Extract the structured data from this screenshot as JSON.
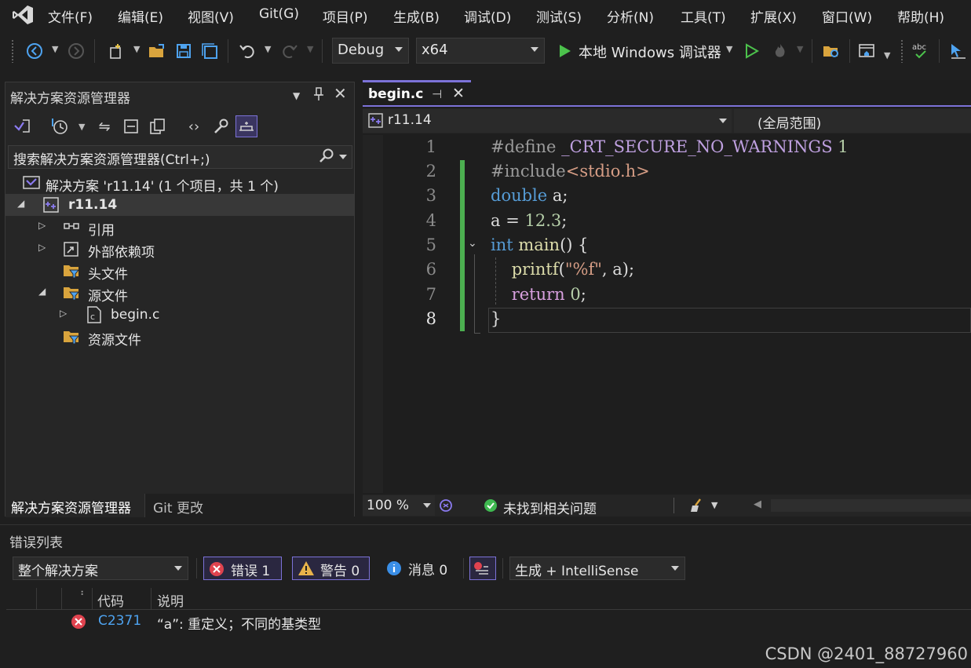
{
  "menubar": {
    "items": [
      "文件(F)",
      "编辑(E)",
      "视图(V)",
      "Git(G)",
      "项目(P)",
      "生成(B)",
      "调试(D)",
      "测试(S)",
      "分析(N)",
      "工具(T)",
      "扩展(X)",
      "窗口(W)",
      "帮助(H)"
    ]
  },
  "toolbar": {
    "configuration": "Debug",
    "platform": "x64",
    "run_label": "本地 Windows 调试器"
  },
  "solution_explorer": {
    "title": "解决方案资源管理器",
    "search_placeholder": "搜索解决方案资源管理器(Ctrl+;)",
    "tree": [
      {
        "label": "解决方案 'r11.14' (1 个项目，共 1 个)"
      },
      {
        "label": "r11.14"
      },
      {
        "label": "引用"
      },
      {
        "label": "外部依赖项"
      },
      {
        "label": "头文件"
      },
      {
        "label": "源文件"
      },
      {
        "label": "begin.c"
      },
      {
        "label": "资源文件"
      }
    ],
    "tabs": [
      "解决方案资源管理器",
      "Git 更改"
    ]
  },
  "editor": {
    "tab_name": "begin.c",
    "nav_scope": "r11.14",
    "nav_member": "(全局范围)",
    "lines": [
      "1",
      "2",
      "3",
      "4",
      "5",
      "6",
      "7",
      "8"
    ],
    "zoom": "100 %",
    "issues": "未找到相关问题"
  },
  "error_list": {
    "title": "错误列表",
    "scope": "整个解决方案",
    "errors_label": "错误 1",
    "warnings_label": "警告 0",
    "messages_label": "消息 0",
    "source": "生成 + IntelliSense",
    "columns": {
      "code": "代码",
      "description": "说明"
    },
    "rows": [
      {
        "code": "C2371",
        "description": "“a”: 重定义；不同的基类型"
      }
    ]
  },
  "watermark": "CSDN @2401_88727960",
  "colors": {
    "accent": "#7c72d8",
    "change_bar": "#4caf50",
    "keyword": "#569cd6",
    "error": "#e0434f"
  }
}
